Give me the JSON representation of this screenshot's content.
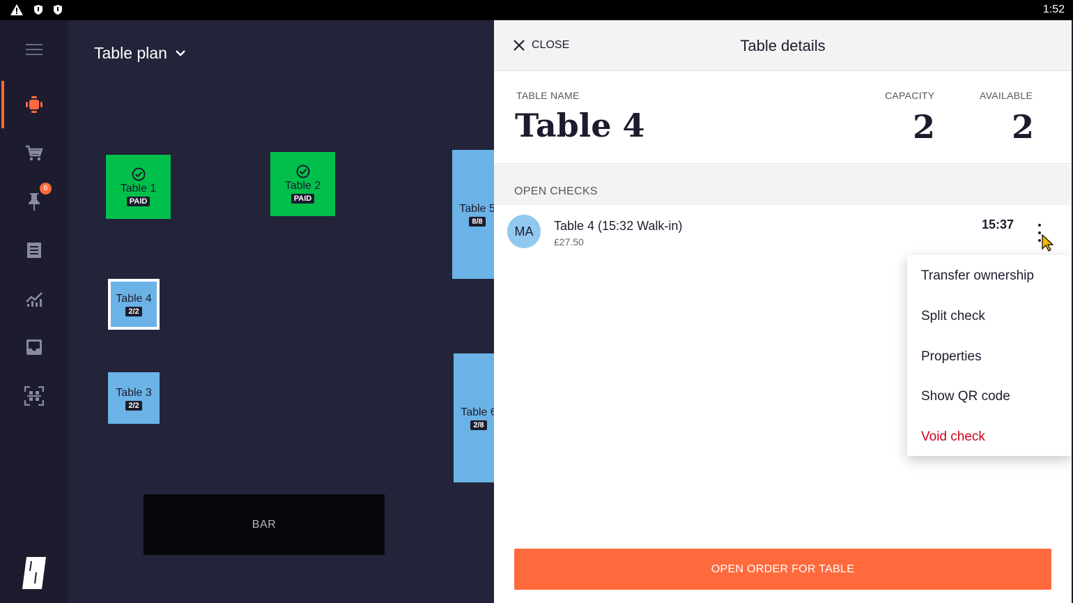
{
  "status_bar": {
    "time": "1:52"
  },
  "sidebar": {
    "items": [
      {
        "icon": "menu-icon"
      },
      {
        "icon": "table-plan-icon",
        "active": true
      },
      {
        "icon": "cart-icon"
      },
      {
        "icon": "pin-icon",
        "badge": "6"
      },
      {
        "icon": "receipt-icon"
      },
      {
        "icon": "analytics-icon"
      },
      {
        "icon": "inbox-icon"
      },
      {
        "icon": "qr-scan-icon"
      }
    ]
  },
  "plan": {
    "title": "Table plan",
    "tables": [
      {
        "name": "Table 1",
        "tag": "PAID",
        "status": "paid"
      },
      {
        "name": "Table 2",
        "tag": "PAID",
        "status": "paid"
      },
      {
        "name": "Table 5",
        "tag": "8/8",
        "status": "open"
      },
      {
        "name": "Table 4",
        "tag": "2/2",
        "status": "open",
        "selected": true
      },
      {
        "name": "Table 3",
        "tag": "2/2",
        "status": "open"
      },
      {
        "name": "Table 6",
        "tag": "2/8",
        "status": "open"
      }
    ],
    "bar_label": "BAR"
  },
  "details": {
    "close_label": "CLOSE",
    "title": "Table details",
    "table_name_label": "TABLE NAME",
    "table_name": "Table 4",
    "capacity_label": "CAPACITY",
    "capacity": "2",
    "available_label": "AVAILABLE",
    "available": "2",
    "open_checks_label": "OPEN CHECKS",
    "checks": [
      {
        "initials": "MA",
        "title": "Table 4 (15:32 Walk-in)",
        "amount": "£27.50",
        "time": "15:37"
      }
    ],
    "menu": [
      "Transfer ownership",
      "Split check",
      "Properties",
      "Show QR code",
      "Void check"
    ],
    "open_order_label": "OPEN ORDER FOR TABLE"
  },
  "colors": {
    "accent": "#ff6a3d",
    "paid": "#00c04b",
    "open_table": "#6bb3e6",
    "danger": "#d0021b",
    "background": "#23233a"
  }
}
